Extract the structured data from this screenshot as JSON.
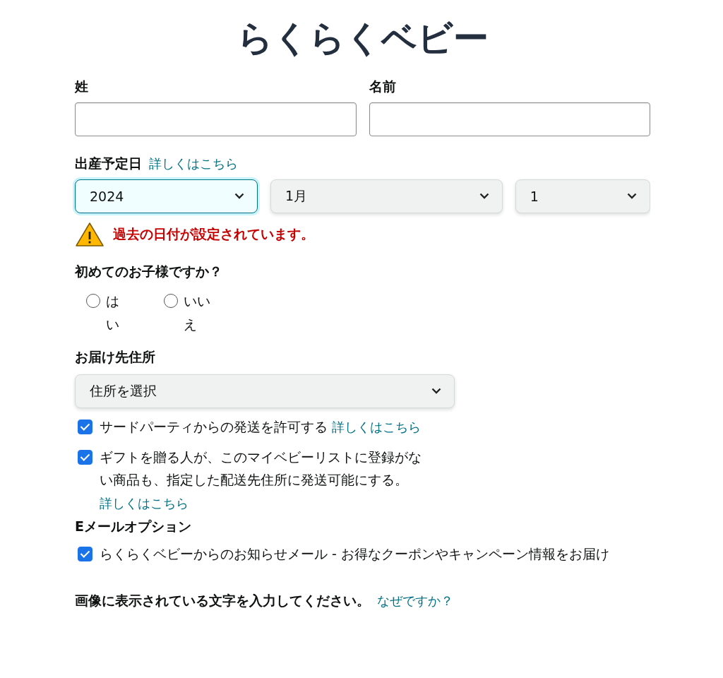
{
  "logo": "らくらくベビー",
  "name_fields": [
    {
      "label": "姓"
    },
    {
      "label": "名前"
    }
  ],
  "due_date": {
    "label": "出産予定日",
    "link": "詳しくはこちら",
    "selects": [
      {
        "value": "2024",
        "focused": true
      },
      {
        "value": "1月",
        "focused": false
      },
      {
        "value": "1",
        "focused": false
      }
    ],
    "warning": "過去の日付が設定されています。"
  },
  "first_child": {
    "label": "初めてのお子様ですか？",
    "options": [
      {
        "label": "はい",
        "selected": false
      },
      {
        "label": "いいえ",
        "selected": false
      }
    ]
  },
  "address": {
    "label": "お届け先住所",
    "select": "住所を選択",
    "options": [
      {
        "text": "サードパーティからの発送を許可する",
        "link": "詳しくはこちら",
        "checked": true
      },
      {
        "text": "ギフトを贈る人が、このマイベビーリストに登録がない商品も、指定した配送先住所に発送可能にする。",
        "link": "詳しくはこちら",
        "checked": true
      }
    ]
  },
  "email": {
    "heading": "Eメールオプション",
    "options": [
      {
        "text": "らくらくベビーからのお知らせメール - お得なクーポンやキャンペーン情報をお届け",
        "checked": true
      }
    ]
  },
  "captcha": {
    "label": "画像に表示されている文字を入力してください。",
    "link": "なぜですか？"
  }
}
